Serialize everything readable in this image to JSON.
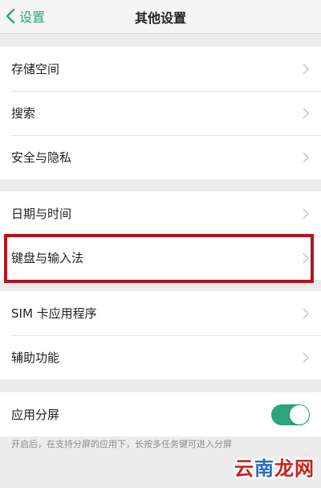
{
  "header": {
    "back_label": "设置",
    "title": "其他设置"
  },
  "groups": [
    {
      "items": [
        {
          "label": "存储空间"
        },
        {
          "label": "搜索"
        },
        {
          "label": "安全与隐私"
        }
      ]
    },
    {
      "items": [
        {
          "label": "日期与时间"
        },
        {
          "label": "键盘与输入法"
        }
      ]
    },
    {
      "items": [
        {
          "label": "SIM 卡应用程序"
        },
        {
          "label": "辅助功能"
        }
      ]
    }
  ],
  "split_screen": {
    "label": "应用分屏",
    "enabled": true,
    "hint": "开启后，在支持分屏的应用下，长按多任务键可进入分屏"
  },
  "watermark": {
    "part1": "云",
    "part2": "南",
    "part3": "龙网"
  },
  "colors": {
    "accent": "#2aa77a",
    "highlight_border": "#b2141b",
    "background": "#ececec"
  }
}
